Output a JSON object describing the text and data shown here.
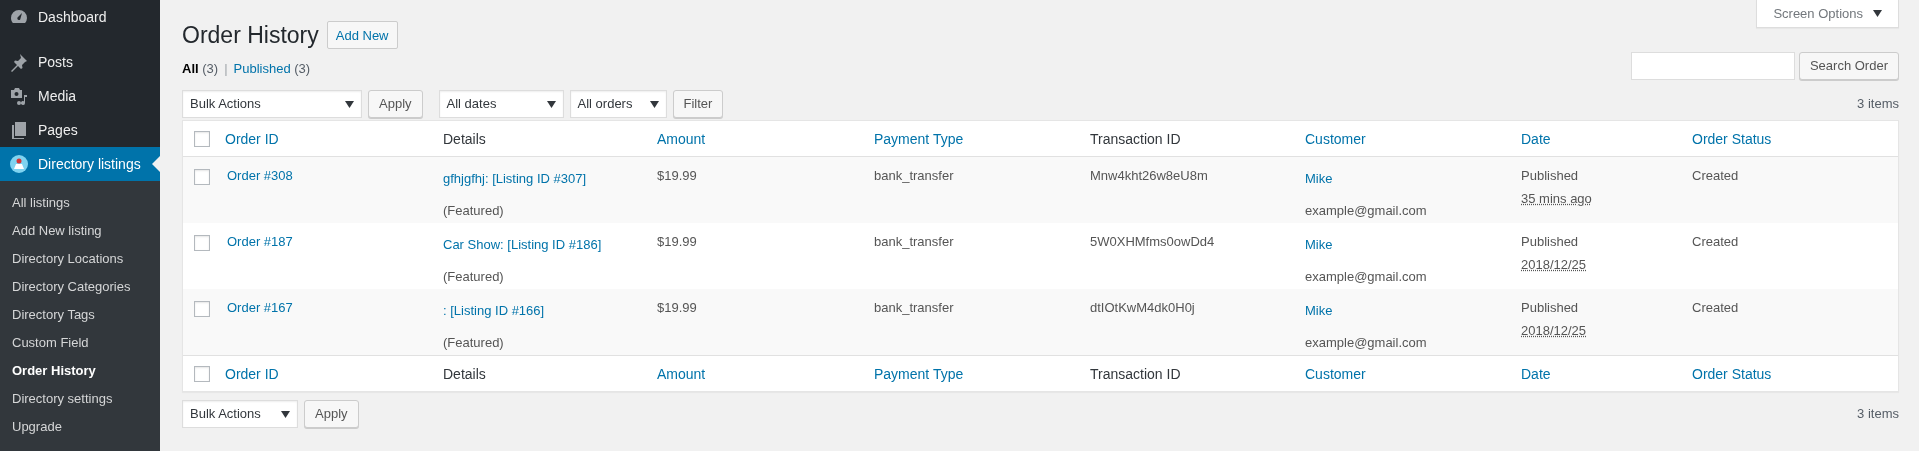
{
  "sidebar": {
    "items": [
      {
        "label": "Dashboard",
        "selected": false
      },
      {
        "label": "Posts",
        "selected": false
      },
      {
        "label": "Media",
        "selected": false
      },
      {
        "label": "Pages",
        "selected": false
      },
      {
        "label": "Directory listings",
        "selected": true,
        "children": [
          {
            "label": "All listings",
            "selected": false
          },
          {
            "label": "Add New listing",
            "selected": false
          },
          {
            "label": "Directory Locations",
            "selected": false
          },
          {
            "label": "Directory Categories",
            "selected": false
          },
          {
            "label": "Directory Tags",
            "selected": false
          },
          {
            "label": "Custom Field",
            "selected": false
          },
          {
            "label": "Order History",
            "selected": true
          },
          {
            "label": "Directory settings",
            "selected": false
          },
          {
            "label": "Upgrade",
            "selected": false
          }
        ]
      }
    ]
  },
  "header": {
    "title": "Order History",
    "add_new": "Add New",
    "screen_options": "Screen Options"
  },
  "views": {
    "separator": "|",
    "items": [
      {
        "label": "All",
        "count": "(3)",
        "selected": true
      },
      {
        "label": "Published",
        "count": "(3)",
        "selected": false
      }
    ]
  },
  "search": {
    "button": "Search Order"
  },
  "top_toolbar": {
    "bulk_actions": "Bulk Actions",
    "apply": "Apply",
    "dates": "All dates",
    "orders": "All orders",
    "filter": "Filter",
    "count": "3 items"
  },
  "table": {
    "select_all_checked": false,
    "footer_select_all_checked": false,
    "columns": [
      {
        "label": "Order ID",
        "sortable": true
      },
      {
        "label": "Details",
        "sortable": false
      },
      {
        "label": "Amount",
        "sortable": true
      },
      {
        "label": "Payment Type",
        "sortable": true
      },
      {
        "label": "Transaction ID",
        "sortable": false
      },
      {
        "label": "Customer",
        "sortable": true
      },
      {
        "label": "Date",
        "sortable": true
      },
      {
        "label": "Order Status",
        "sortable": true
      }
    ],
    "rows": [
      {
        "checked": false,
        "order": "Order #308",
        "details": "gfhjgfhj: [Listing ID #307]",
        "note": "(Featured)",
        "amount": "$19.99",
        "payment": "bank_transfer",
        "transaction": "Mnw4kht26w8eU8m",
        "customer": "Mike",
        "email": "example@gmail.com",
        "status": "Published",
        "date": "35 mins ago",
        "order_status": "Created"
      },
      {
        "checked": false,
        "order": "Order #187",
        "details": "Car Show: [Listing ID #186]",
        "note": "(Featured)",
        "amount": "$19.99",
        "payment": "bank_transfer",
        "transaction": "5W0XHMfms0owDd4",
        "customer": "Mike",
        "email": "example@gmail.com",
        "status": "Published",
        "date": "2018/12/25",
        "order_status": "Created"
      },
      {
        "checked": false,
        "order": "Order #167",
        "details": ": [Listing ID #166]",
        "note": "(Featured)",
        "amount": "$19.99",
        "payment": "bank_transfer",
        "transaction": "dtIOtKwM4dk0H0j",
        "customer": "Mike",
        "email": "example@gmail.com",
        "status": "Published",
        "date": "2018/12/25",
        "order_status": "Created"
      }
    ],
    "footer_columns": [
      {
        "label": "Order ID",
        "sortable": true
      },
      {
        "label": "Details",
        "sortable": false
      },
      {
        "label": "Amount",
        "sortable": true
      },
      {
        "label": "Payment Type",
        "sortable": true
      },
      {
        "label": "Transaction ID",
        "sortable": false
      },
      {
        "label": "Customer",
        "sortable": true
      },
      {
        "label": "Date",
        "sortable": true
      },
      {
        "label": "Order Status",
        "sortable": true
      }
    ]
  },
  "bottom_toolbar": {
    "bulk_actions": "Bulk Actions",
    "apply": "Apply",
    "count": "3 items"
  }
}
